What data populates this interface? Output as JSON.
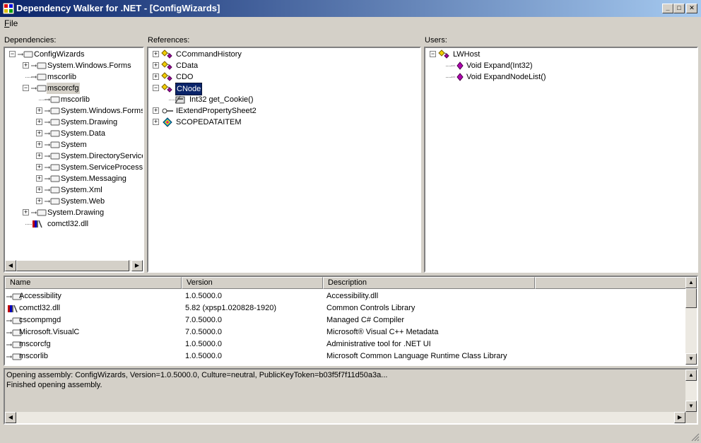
{
  "window": {
    "title": "Dependency Walker for .NET - [ConfigWizards]",
    "minimize_glyph": "_",
    "maximize_glyph": "□",
    "close_glyph": "✕"
  },
  "menu": {
    "file_accel": "F",
    "file_rest": "ile"
  },
  "panes": {
    "dependencies": "Dependencies:",
    "references": "References:",
    "users": "Users:"
  },
  "dependencies_tree": [
    {
      "label": "ConfigWizards",
      "level": 0,
      "expander": "-",
      "icon": "assembly-icon"
    },
    {
      "label": "System.Windows.Forms",
      "level": 1,
      "expander": "+",
      "icon": "assembly-icon"
    },
    {
      "label": "mscorlib",
      "level": 1,
      "expander": "",
      "icon": "assembly-icon"
    },
    {
      "label": "mscorcfg",
      "level": 1,
      "expander": "-",
      "icon": "assembly-icon",
      "selected": true
    },
    {
      "label": "mscorlib",
      "level": 2,
      "expander": "",
      "icon": "assembly-icon"
    },
    {
      "label": "System.Windows.Forms",
      "level": 2,
      "expander": "+",
      "icon": "assembly-icon"
    },
    {
      "label": "System.Drawing",
      "level": 2,
      "expander": "+",
      "icon": "assembly-icon"
    },
    {
      "label": "System.Data",
      "level": 2,
      "expander": "+",
      "icon": "assembly-icon"
    },
    {
      "label": "System",
      "level": 2,
      "expander": "+",
      "icon": "assembly-icon"
    },
    {
      "label": "System.DirectoryServices",
      "level": 2,
      "expander": "+",
      "icon": "assembly-icon"
    },
    {
      "label": "System.ServiceProcess",
      "level": 2,
      "expander": "+",
      "icon": "assembly-icon"
    },
    {
      "label": "System.Messaging",
      "level": 2,
      "expander": "+",
      "icon": "assembly-icon"
    },
    {
      "label": "System.Xml",
      "level": 2,
      "expander": "+",
      "icon": "assembly-icon"
    },
    {
      "label": "System.Web",
      "level": 2,
      "expander": "+",
      "icon": "assembly-icon"
    },
    {
      "label": "System.Drawing",
      "level": 1,
      "expander": "+",
      "icon": "assembly-icon"
    },
    {
      "label": "comctl32.dll",
      "level": 1,
      "expander": "",
      "icon": "native-dll-icon"
    }
  ],
  "references_tree": [
    {
      "label": "CCommandHistory",
      "level": 0,
      "expander": "+",
      "icon": "class-icon"
    },
    {
      "label": "CData",
      "level": 0,
      "expander": "+",
      "icon": "class-icon"
    },
    {
      "label": "CDO",
      "level": 0,
      "expander": "+",
      "icon": "class-icon"
    },
    {
      "label": "CNode",
      "level": 0,
      "expander": "-",
      "icon": "class-icon",
      "focused": true
    },
    {
      "label": "Int32 get_Cookie()",
      "level": 1,
      "expander": "",
      "icon": "property-icon"
    },
    {
      "label": "IExtendPropertySheet2",
      "level": 0,
      "expander": "+",
      "icon": "interface-icon"
    },
    {
      "label": "SCOPEDATAITEM",
      "level": 0,
      "expander": "+",
      "icon": "struct-icon"
    }
  ],
  "users_tree": [
    {
      "label": "LWHost",
      "level": 0,
      "expander": "-",
      "icon": "class-icon"
    },
    {
      "label": "Void Expand(Int32)",
      "level": 1,
      "expander": "",
      "icon": "method-icon"
    },
    {
      "label": "Void ExpandNodeList()",
      "level": 1,
      "expander": "",
      "icon": "method-icon"
    }
  ],
  "assembly_list": {
    "columns": [
      "Name",
      "Version",
      "Description"
    ],
    "rows": [
      {
        "name": "Accessibility",
        "version": "1.0.5000.0",
        "description": "Accessibility.dll",
        "icon": "assembly-icon"
      },
      {
        "name": "comctl32.dll",
        "version": "5.82 (xpsp1.020828-1920)",
        "description": "Common Controls Library",
        "icon": "native-dll-icon"
      },
      {
        "name": "cscompmgd",
        "version": "7.0.5000.0",
        "description": "Managed C# Compiler",
        "icon": "assembly-icon"
      },
      {
        "name": "Microsoft.VisualC",
        "version": "7.0.5000.0",
        "description": "Microsoft® Visual C++ Metadata",
        "icon": "assembly-icon"
      },
      {
        "name": "mscorcfg",
        "version": "1.0.5000.0",
        "description": "Administrative tool for .NET UI",
        "icon": "assembly-icon"
      },
      {
        "name": "mscorlib",
        "version": "1.0.5000.0",
        "description": "Microsoft Common Language Runtime Class Library",
        "icon": "assembly-icon"
      }
    ]
  },
  "log": [
    "Opening assembly: ConfigWizards, Version=1.0.5000.0, Culture=neutral, PublicKeyToken=b03f5f7f11d50a3a...",
    "Finished opening assembly."
  ],
  "scroll_glyphs": {
    "left": "◀",
    "right": "▶",
    "up": "▲",
    "down": "▼"
  },
  "colors": {
    "titlebar_start": "#0a246a",
    "titlebar_end": "#a6caf0",
    "face": "#d4d0c8",
    "selection": "#0a246a"
  }
}
